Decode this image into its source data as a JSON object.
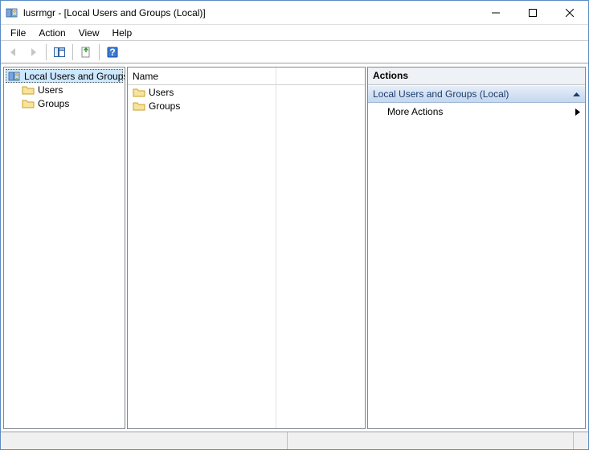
{
  "window": {
    "title": "lusrmgr - [Local Users and Groups (Local)]"
  },
  "menu": {
    "file": "File",
    "action": "Action",
    "view": "View",
    "help": "Help"
  },
  "tree": {
    "root": "Local Users and Groups (Local)",
    "children": [
      {
        "label": "Users"
      },
      {
        "label": "Groups"
      }
    ]
  },
  "list": {
    "columns": {
      "name": "Name"
    },
    "rows": [
      {
        "name": "Users"
      },
      {
        "name": "Groups"
      }
    ]
  },
  "actions": {
    "header": "Actions",
    "section": "Local Users and Groups (Local)",
    "more": "More Actions"
  }
}
